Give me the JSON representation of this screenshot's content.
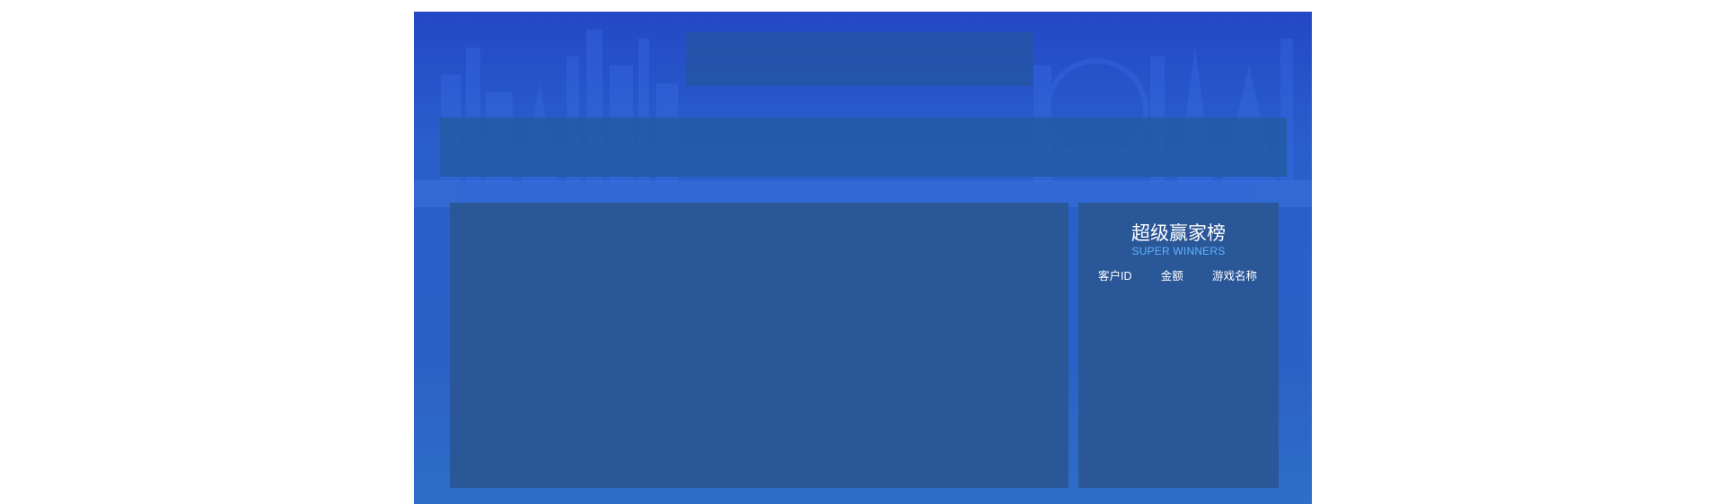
{
  "winners": {
    "title": "超级赢家榜",
    "subtitle": "SUPER WINNERS",
    "columns": [
      "客户ID",
      "金额",
      "游戏名称"
    ],
    "rows": []
  },
  "colors": {
    "background": "#2a5fcb",
    "panel": "#2a5798",
    "subtitle": "#5fb2ff"
  }
}
